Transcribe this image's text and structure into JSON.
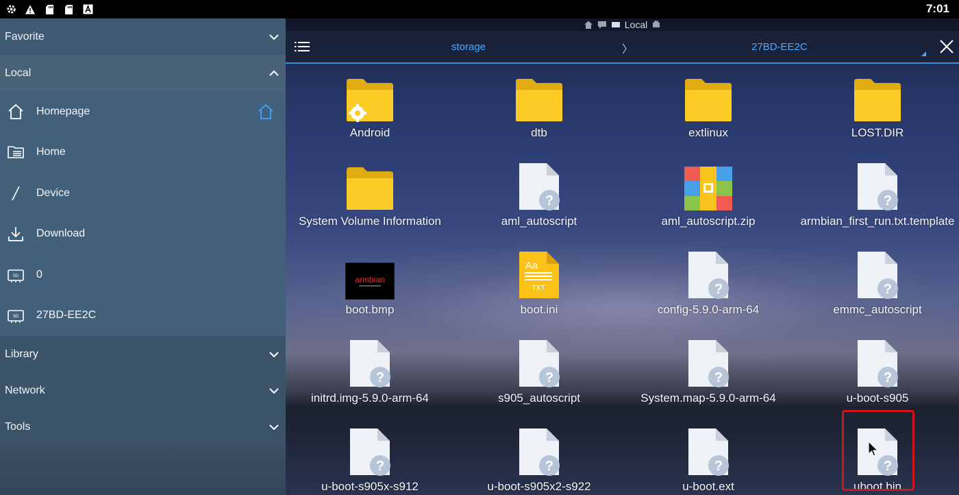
{
  "status_bar": {
    "time": "7:01",
    "icons": [
      "settings-icon",
      "warning-icon",
      "sd-card-icon",
      "sd-card-icon",
      "a-box-icon"
    ]
  },
  "sidebar": {
    "favorite": "Favorite",
    "local": "Local",
    "local_items": [
      {
        "label": "Homepage",
        "icon": "home-icon"
      },
      {
        "label": "Home",
        "icon": "folder-list-icon"
      },
      {
        "label": "Device",
        "icon": "slash-icon"
      },
      {
        "label": "Download",
        "icon": "download-icon"
      },
      {
        "label": "0",
        "icon": "sd-card-icon"
      },
      {
        "label": "27BD-EE2C",
        "icon": "sd-card-icon"
      }
    ],
    "library": "Library",
    "network": "Network",
    "tools": "Tools"
  },
  "header": {
    "location": "Local"
  },
  "toolbar": {
    "path_1": "storage",
    "separator": "〉",
    "path_2": "27BD-EE2C"
  },
  "files": [
    {
      "name": "Android",
      "type": "folder-gear"
    },
    {
      "name": "dtb",
      "type": "folder"
    },
    {
      "name": "extlinux",
      "type": "folder"
    },
    {
      "name": "LOST.DIR",
      "type": "folder"
    },
    {
      "name": "System Volume Information",
      "type": "folder"
    },
    {
      "name": "aml_autoscript",
      "type": "unknown"
    },
    {
      "name": "aml_autoscript.zip",
      "type": "zip"
    },
    {
      "name": "armbian_first_run.txt.template",
      "type": "unknown"
    },
    {
      "name": "boot.bmp",
      "type": "image"
    },
    {
      "name": "boot.ini",
      "type": "text"
    },
    {
      "name": "config-5.9.0-arm-64",
      "type": "unknown"
    },
    {
      "name": "emmc_autoscript",
      "type": "unknown"
    },
    {
      "name": "initrd.img-5.9.0-arm-64",
      "type": "unknown"
    },
    {
      "name": "s905_autoscript",
      "type": "unknown"
    },
    {
      "name": "System.map-5.9.0-arm-64",
      "type": "unknown"
    },
    {
      "name": "u-boot-s905",
      "type": "unknown"
    },
    {
      "name": "u-boot-s905x-s912",
      "type": "unknown"
    },
    {
      "name": "u-boot-s905x2-s922",
      "type": "unknown"
    },
    {
      "name": "u-boot.ext",
      "type": "unknown"
    },
    {
      "name": "uboot.bin",
      "type": "unknown"
    }
  ],
  "icon_labels": {
    "txt_aa": "Aa",
    "txt_ext": "TXT",
    "bmp_brand": "armbian"
  },
  "colors": {
    "accent": "#2c8fe6",
    "folder": "#f9c51d",
    "highlight": "#d0161c"
  }
}
